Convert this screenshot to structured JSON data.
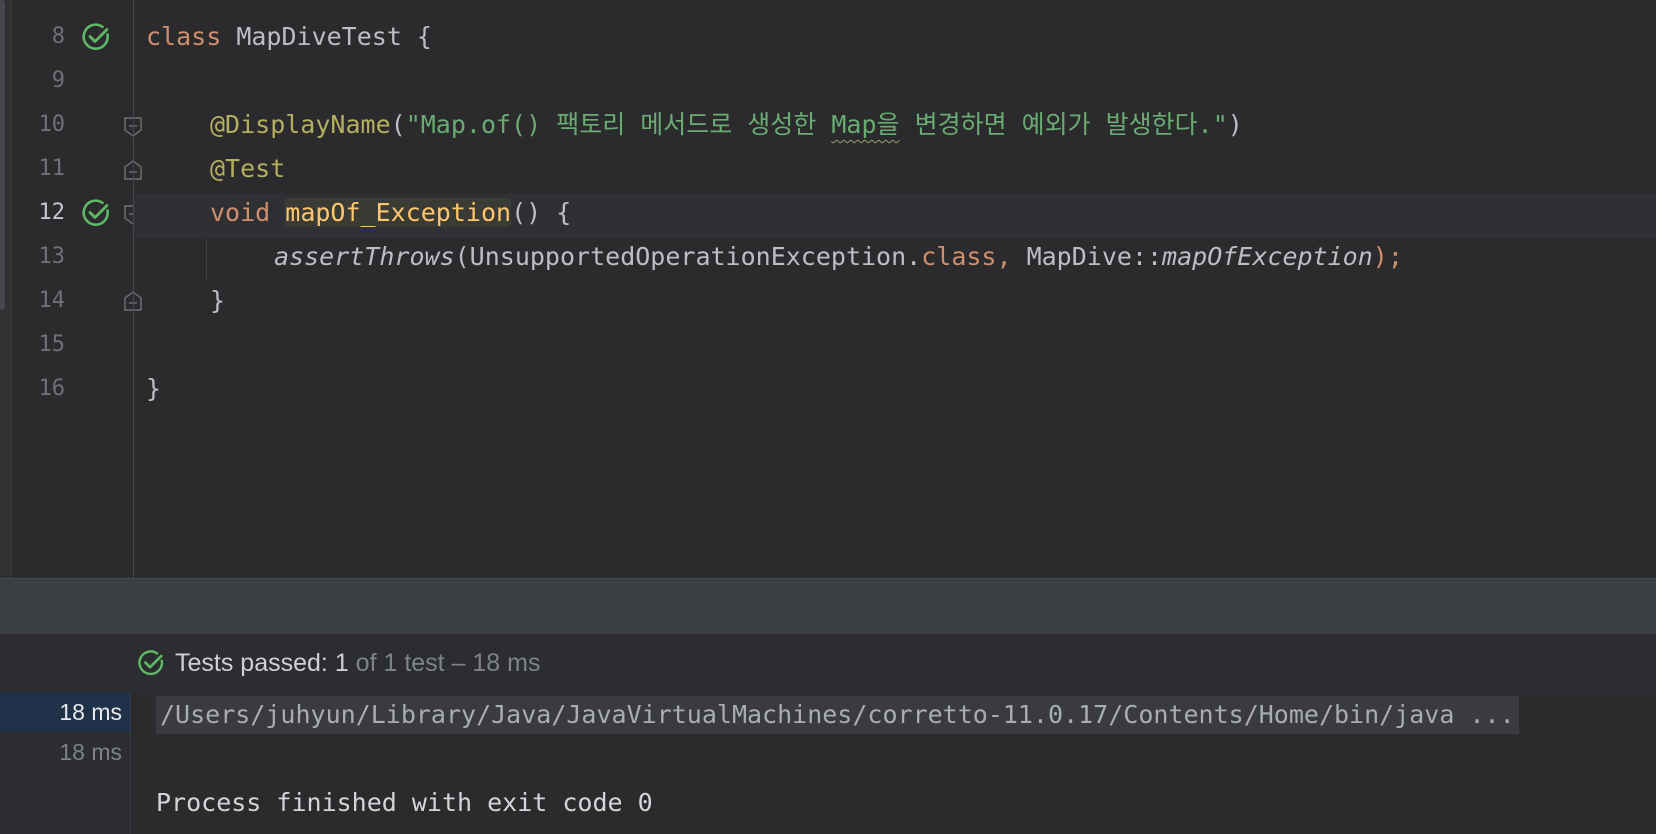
{
  "editor": {
    "line_numbers": [
      "8",
      "9",
      "10",
      "11",
      "12",
      "13",
      "14",
      "15",
      "16"
    ],
    "current_line": "12",
    "code": {
      "l8_kw": "class",
      "l8_name": " MapDiveTest {",
      "l10_ann": "@DisplayName",
      "l10_open": "(",
      "l10_str_a": "\"Map.of() 팩토리 메서드로 생성한 ",
      "l10_str_b": "Map을",
      "l10_str_c": " 변경하면 예외가 발생한다.\"",
      "l10_close": ")",
      "l11_ann": "@Test",
      "l12_kw": "void",
      "l12_sp": " ",
      "l12_fn": "mapOf_Exception",
      "l12_rest": "() {",
      "l13_call": "assertThrows",
      "l13_arg": "(UnsupportedOperationException.",
      "l13_kw": "class,",
      "l13_ref": " MapDive::",
      "l13_method": "mapOfException",
      "l13_end": ");",
      "l14": "}",
      "l16": "}"
    }
  },
  "run_panel": {
    "status": {
      "label": "Tests passed:",
      "count": "1",
      "detail": "of 1 test – 18 ms"
    },
    "tree": [
      {
        "duration": "18 ms",
        "selected": true
      },
      {
        "duration": "18 ms",
        "selected": false
      }
    ],
    "console": {
      "command": "/Users/juhyun/Library/Java/JavaVirtualMachines/corretto-11.0.17/Contents/Home/bin/java ...",
      "exit_message": "Process finished with exit code 0"
    }
  },
  "colors": {
    "pass_green": "#5fb865",
    "keyword": "#cf8e6d",
    "annotation": "#b3ae60",
    "string": "#6aab73",
    "method_highlight": "#ffc66d"
  },
  "icons": {
    "run_gutter": "check-circle-icon",
    "fold": "fold-marker-icon",
    "status": "check-circle-icon"
  }
}
